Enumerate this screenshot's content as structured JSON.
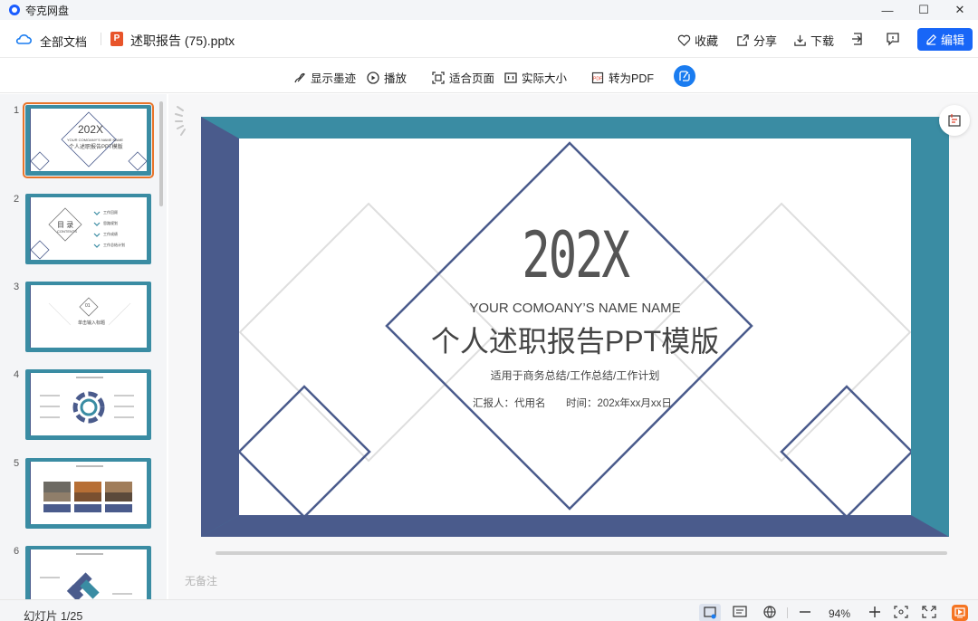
{
  "window": {
    "app_name": "夸克网盘",
    "minimize": "—",
    "maximize": "☐",
    "close": "✕"
  },
  "header": {
    "all_docs": "全部文档",
    "file_name": "述职报告 (75).pptx",
    "file_icon": "P",
    "collect": "收藏",
    "share": "分享",
    "download": "下载",
    "edit": "编辑"
  },
  "toolbar": {
    "show_ink": "显示墨迹",
    "play": "播放",
    "fit_page": "适合页面",
    "actual_size": "实际大小",
    "to_pdf": "转为PDF"
  },
  "thumbnails": {
    "numbers": [
      "1",
      "2",
      "3",
      "4",
      "5",
      "6"
    ],
    "t1_year": "202X",
    "t1_en": "YOUR COMOANY'S NAME NAME",
    "t1_cn": "个人述职报告PPT模版",
    "t2_title": "目 录",
    "t2_sub": "CONTENTS",
    "t2_items": [
      "工作回顾",
      "思路规划",
      "工作成绩",
      "工作总结计划"
    ],
    "t3_num": "01",
    "t3_title": "单击输入标题"
  },
  "slide": {
    "year": "202X",
    "company": "YOUR COMOANY’S NAME NAME",
    "title": "个人述职报告PPT模版",
    "subtitle": "适用于商务总结/工作总结/工作计划",
    "reporter": "汇报人：代用名",
    "time": "时间：202x年xx月xx日"
  },
  "notes": {
    "placeholder": "无备注"
  },
  "status": {
    "slide_counter": "幻灯片 1/25",
    "zoom": "94%"
  },
  "colors": {
    "accent": "#1866f7",
    "teal": "#3a8ca3",
    "navy": "#4a5b8c",
    "selected": "#e8742a"
  }
}
